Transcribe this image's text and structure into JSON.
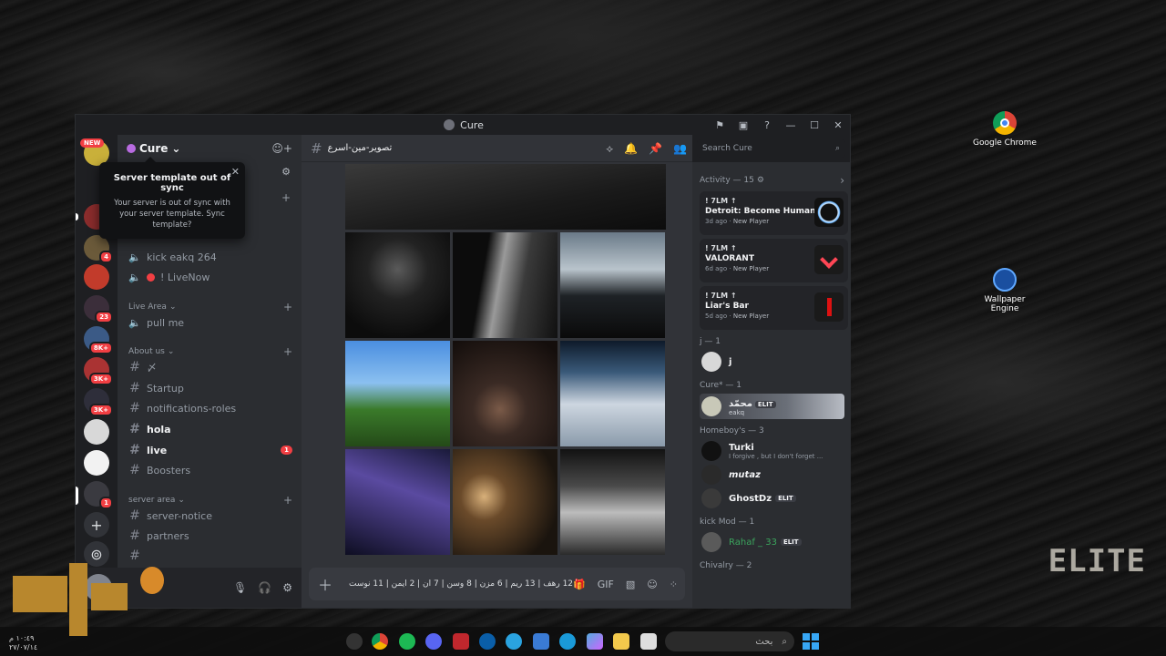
{
  "desktop": {
    "icons": [
      {
        "label": "Google Chrome",
        "icon": "chrome-icon"
      },
      {
        "label": "Wallpaper Engine",
        "icon": "wallpaper-engine-icon"
      }
    ],
    "clock_time": "١٠:٤٩ م",
    "clock_date": "٢٧/٠٧/١٤",
    "overlay_right": "ELITE"
  },
  "window": {
    "title": "Cure"
  },
  "rail": {
    "new_badge": "NEW",
    "badges": [
      "4",
      "23",
      "8K+",
      "3K+",
      "3K+",
      "1"
    ]
  },
  "sidebar": {
    "server_name": "Cure",
    "popup": {
      "title": "Server template out of sync",
      "body": "Your server is out of sync with your server template. Sync template?"
    },
    "voice_channels": [
      {
        "name": "kick eakq 264"
      },
      {
        "name": "! LiveNow"
      }
    ],
    "categories": {
      "live_area": "Live Area",
      "about_us": "About us",
      "server_area": "server area"
    },
    "live_area_channels": [
      {
        "name": "pull me"
      }
    ],
    "about_channels": [
      {
        "name": "〆"
      },
      {
        "name": "Startup"
      },
      {
        "name": "notifications-roles"
      },
      {
        "name": "hola"
      },
      {
        "name": "live",
        "unread": "1"
      },
      {
        "name": "Boosters"
      }
    ],
    "server_area_channels": [
      {
        "name": "server-notice"
      },
      {
        "name": "partners"
      }
    ]
  },
  "main": {
    "channel_name": "تصوير-مين-اسرع",
    "composer_text": "12 رهف | 13 ريم | 6 مزن | 8 وسن | 7 ان | 2 ايمن | 11 نوست"
  },
  "search": {
    "placeholder": "Search Cure"
  },
  "members": {
    "activity_title": "Activity — 15",
    "activities": [
      {
        "user": "! 7LM ↑",
        "game": "Detroit: Become Human",
        "ago": "3d ago",
        "tag": "New Player"
      },
      {
        "user": "! 7LM ↑",
        "game": "VALORANT",
        "ago": "6d ago",
        "tag": "New Player"
      },
      {
        "user": "! 7LM ↑",
        "game": "Liar's Bar",
        "ago": "5d ago",
        "tag": "New Player"
      }
    ],
    "groups": [
      {
        "title": "j — 1",
        "members": [
          {
            "name": "j",
            "sub": ""
          }
        ]
      },
      {
        "title": "Cure* — 1",
        "members": [
          {
            "name": "محمّد",
            "sub": "eakq",
            "badge": "ELIT"
          }
        ]
      },
      {
        "title": "Homeboy's — 3",
        "members": [
          {
            "name": "Turki",
            "sub": "I forgive , but I don't forget ..."
          },
          {
            "name": "mutaz",
            "sub": ""
          },
          {
            "name": "GhostDz",
            "sub": "",
            "badge": "ELIT"
          }
        ]
      },
      {
        "title": "kick Mod — 1",
        "members": [
          {
            "name": "Rahaf _ 33",
            "sub": "",
            "badge": "ELIT"
          }
        ]
      },
      {
        "title": "Chivalry — 2",
        "members": []
      }
    ]
  },
  "taskbar": {
    "search_text": "بحث"
  },
  "colors": {
    "accent": "#5865f2",
    "danger": "#f23f43",
    "online": "#23a55a"
  }
}
